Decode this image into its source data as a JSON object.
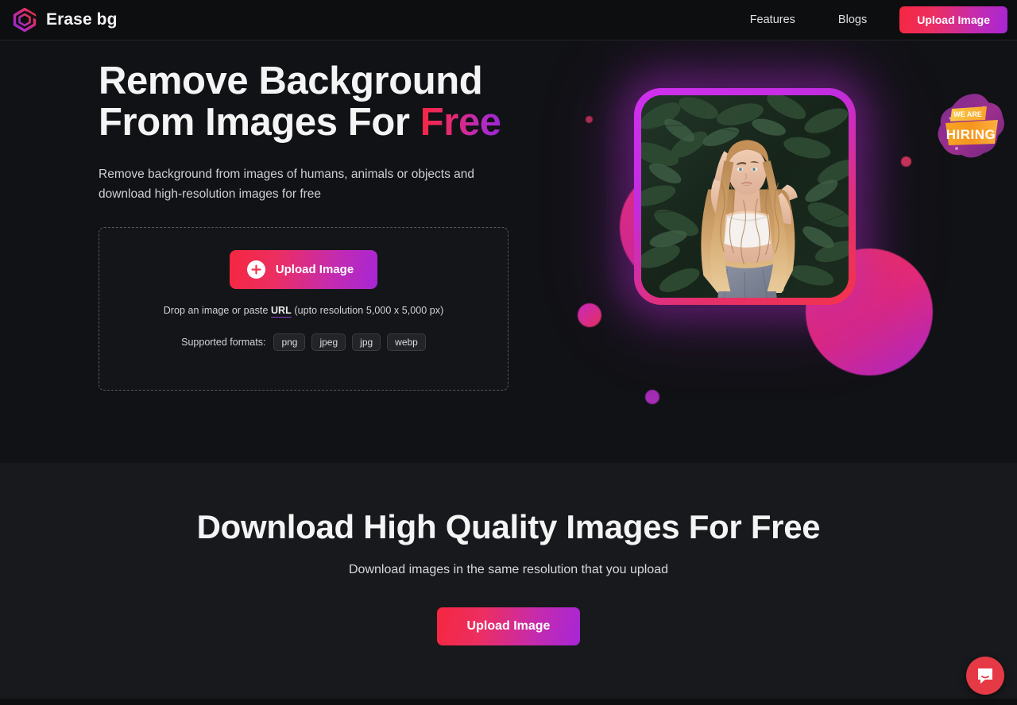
{
  "header": {
    "brand_name": "Erase bg",
    "logo_icon": "erasebg-diamond-logo-icon",
    "nav_links": [
      {
        "label": "Features"
      },
      {
        "label": "Blogs"
      }
    ],
    "upload_button_label": "Upload Image"
  },
  "hero": {
    "title_line1": "Remove Background",
    "title_line2_prefix": "From Images For ",
    "title_line2_accent": "Free",
    "subtitle": "Remove background from images of humans, animals or objects and download high-resolution images for free",
    "dropzone": {
      "upload_button_label": "Upload Image",
      "plus_icon": "plus-icon",
      "hint_prefix": "Drop an image or paste ",
      "hint_url_link": "URL",
      "hint_suffix": " (upto resolution 5,000 x 5,000 px)",
      "formats_label": "Supported formats:",
      "formats": [
        "png",
        "jpeg",
        "jpg",
        "webp"
      ]
    },
    "art": {
      "photo_alt": "woman-with-long-wavy-hair-in-front-of-green-leaves",
      "frame_icon": "glowing-gradient-photo-frame"
    },
    "hiring_badge": {
      "line1": "WE ARE",
      "line2": "HIRING"
    }
  },
  "download_section": {
    "title": "Download High Quality Images For Free",
    "subtitle": "Download images in the same resolution that you upload",
    "upload_button_label": "Upload Image"
  },
  "chat_widget": {
    "icon": "chat-bubble-icon"
  },
  "colors": {
    "page_bg": "#111215",
    "header_bg": "#0d0e10",
    "section_bg": "#17191c",
    "gradient_start": "#f5273f",
    "gradient_end": "#a726d6",
    "chat_bg": "#e63946",
    "link_underline": "#8b3cc9"
  }
}
